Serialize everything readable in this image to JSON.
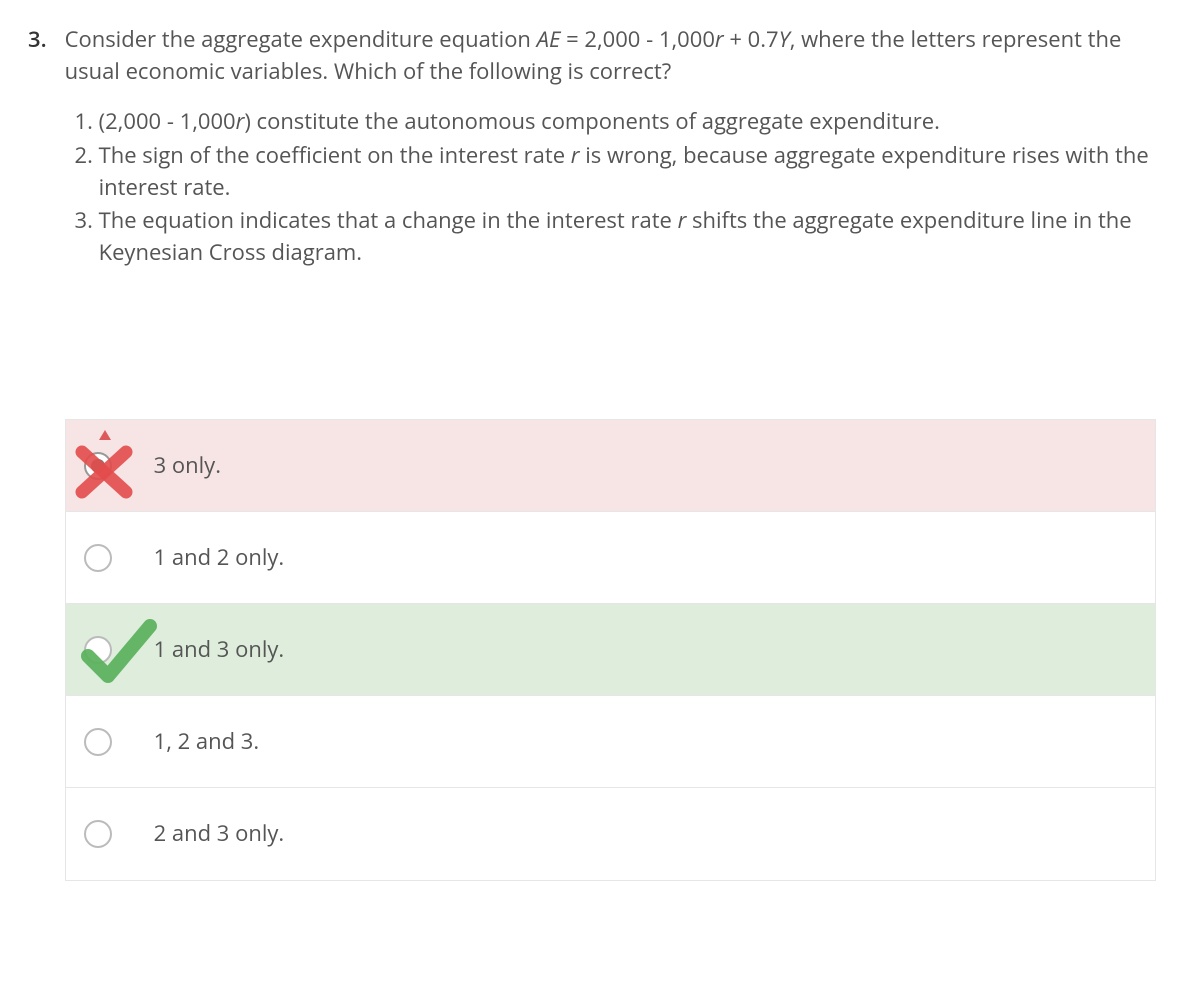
{
  "question": {
    "number": "3.",
    "prompt_pre": "Consider the aggregate expenditure equation ",
    "prompt_eq_left": "AE",
    "prompt_eq_mid": " = 2,000 - 1,000",
    "prompt_eq_r": "r",
    "prompt_eq_tail": " + 0.7",
    "prompt_eq_y": "Y",
    "prompt_post": ", where the letters represent the usual economic variables. Which of the following is correct?",
    "statements": {
      "s1_pre": "(2,000 - 1,000",
      "s1_r": "r",
      "s1_post": ") constitute the autonomous components of aggregate expenditure.",
      "s2_pre": "The sign of the coefficient on the interest rate ",
      "s2_r": "r ",
      "s2_post": "is wrong, because aggregate expenditure rises with the interest rate.",
      "s3_pre": "The equation indicates that a change in the interest rate ",
      "s3_r": "r ",
      "s3_post": "shifts the aggregate expenditure line in the Keynesian Cross diagram."
    }
  },
  "answers": {
    "a": "3 only.",
    "b": "1 and 2 only.",
    "c": "1 and 3 only.",
    "d": "1, 2 and 3.",
    "e": "2 and 3 only."
  },
  "colors": {
    "incorrect_bg": "#f7e4e4",
    "correct_bg": "#dfeedc",
    "x_color": "#e44c4c",
    "check_color": "#59b15b"
  }
}
